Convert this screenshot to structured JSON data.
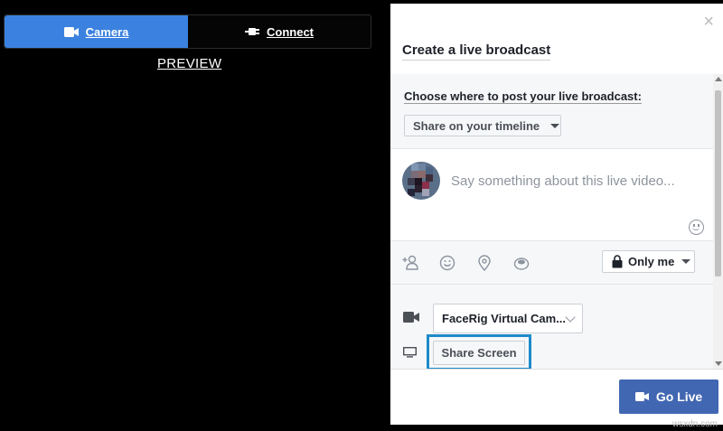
{
  "tabs": {
    "camera_label": "Camera",
    "connect_label": "Connect"
  },
  "preview_label": "PREVIEW",
  "panel": {
    "close_glyph": "×",
    "title": "Create a live broadcast",
    "choose_label": "Choose where to post your live broadcast:",
    "share_dropdown_value": "Share on your timeline",
    "composer_placeholder": "Say something about this live video...",
    "audience_value": "Only me",
    "camera_source_value": "FaceRig Virtual Cam...",
    "share_screen_label": "Share Screen",
    "go_live_label": "Go Live"
  },
  "icons": {
    "tab_camera": "video-camera-icon",
    "tab_connect": "plug-icon",
    "tag_people": "tag-person-icon",
    "feeling": "smiley-icon",
    "location": "location-pin-icon",
    "sticker": "sticker-icon",
    "lock": "lock-icon",
    "source_camera": "video-camera-icon",
    "source_screen": "monitor-icon",
    "go_live": "video-camera-icon"
  },
  "colors": {
    "camera_tab": "#3b82e0",
    "go_live": "#4267b2",
    "highlight": "#1d8ac9"
  },
  "watermark": "wsxdn.com"
}
